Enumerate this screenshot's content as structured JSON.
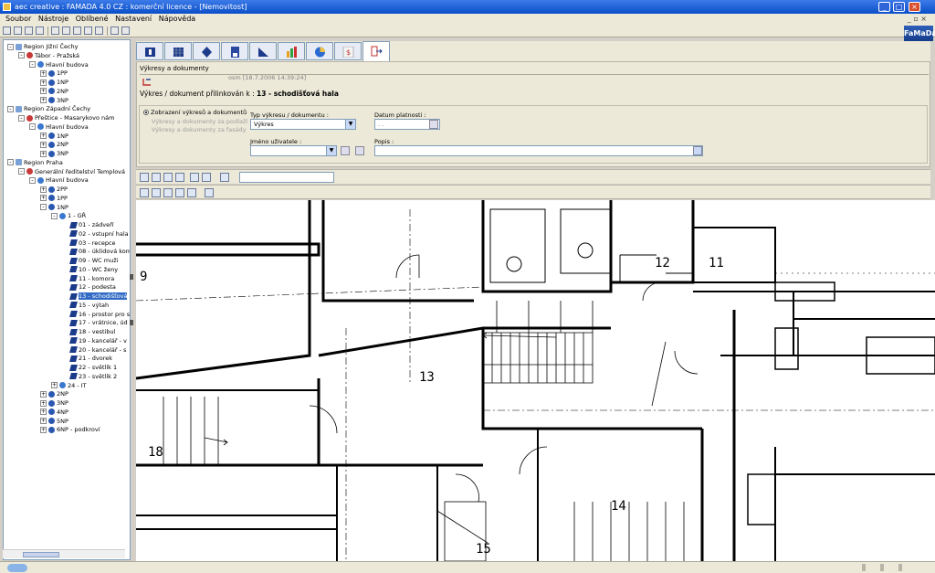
{
  "window": {
    "title": "aec creative : FAMADA 4.0 CZ : komerční licence - [Nemovitost]"
  },
  "menu": [
    "Soubor",
    "Nástroje",
    "Oblíbené",
    "Nastavení",
    "Nápověda"
  ],
  "logo": "FaMaDa",
  "tree": [
    {
      "label": "Region Jižní Čechy",
      "level": 0,
      "type": "region",
      "exp": "-"
    },
    {
      "label": "Tábor - Pražská",
      "level": 1,
      "type": "site",
      "exp": "-"
    },
    {
      "label": "Hlavní budova",
      "level": 2,
      "type": "bldg",
      "exp": "-"
    },
    {
      "label": "1PP",
      "level": 3,
      "type": "floor",
      "exp": "+"
    },
    {
      "label": "1NP",
      "level": 3,
      "type": "floor",
      "exp": "+"
    },
    {
      "label": "2NP",
      "level": 3,
      "type": "floor",
      "exp": "+"
    },
    {
      "label": "3NP",
      "level": 3,
      "type": "floor",
      "exp": "+"
    },
    {
      "label": "Region Západní Čechy",
      "level": 0,
      "type": "region",
      "exp": "-"
    },
    {
      "label": "Přeštice - Masarykovo nám",
      "level": 1,
      "type": "site",
      "exp": "-"
    },
    {
      "label": "Hlavní budova",
      "level": 2,
      "type": "bldg",
      "exp": "-"
    },
    {
      "label": "1NP",
      "level": 3,
      "type": "floor",
      "exp": "+"
    },
    {
      "label": "2NP",
      "level": 3,
      "type": "floor",
      "exp": "+"
    },
    {
      "label": "3NP",
      "level": 3,
      "type": "floor",
      "exp": "+"
    },
    {
      "label": "Region Praha",
      "level": 0,
      "type": "region",
      "exp": "-"
    },
    {
      "label": "Generální ředitelství Templová",
      "level": 1,
      "type": "site",
      "exp": "-"
    },
    {
      "label": "Hlavní budova",
      "level": 2,
      "type": "bldg",
      "exp": "-"
    },
    {
      "label": "2PP",
      "level": 3,
      "type": "floor",
      "exp": "+"
    },
    {
      "label": "1PP",
      "level": 3,
      "type": "floor",
      "exp": "+"
    },
    {
      "label": "1NP",
      "level": 3,
      "type": "floor",
      "exp": "-"
    },
    {
      "label": "1 - GŘ",
      "level": 4,
      "type": "bldg",
      "exp": "-"
    },
    {
      "label": "01 - zádveří",
      "level": 5,
      "type": "room"
    },
    {
      "label": "02 - vstupní hala",
      "level": 5,
      "type": "room"
    },
    {
      "label": "03 - recepce",
      "level": 5,
      "type": "room"
    },
    {
      "label": "08 - úklidová kom",
      "level": 5,
      "type": "room"
    },
    {
      "label": "09 - WC muži",
      "level": 5,
      "type": "room"
    },
    {
      "label": "10 - WC ženy",
      "level": 5,
      "type": "room"
    },
    {
      "label": "11 - komora",
      "level": 5,
      "type": "room"
    },
    {
      "label": "12 - podesta",
      "level": 5,
      "type": "room"
    },
    {
      "label": "13 - schodišťová",
      "level": 5,
      "type": "room",
      "selected": true
    },
    {
      "label": "15 - výtah",
      "level": 5,
      "type": "room"
    },
    {
      "label": "16 - prostor pro s",
      "level": 5,
      "type": "room"
    },
    {
      "label": "17 - vrátnice, úd",
      "level": 5,
      "type": "room"
    },
    {
      "label": "18 - vestibul",
      "level": 5,
      "type": "room"
    },
    {
      "label": "19 - kancelář - v",
      "level": 5,
      "type": "room"
    },
    {
      "label": "20 - kancelář - s",
      "level": 5,
      "type": "room"
    },
    {
      "label": "21 - dvorek",
      "level": 5,
      "type": "room"
    },
    {
      "label": "22 - světlík 1",
      "level": 5,
      "type": "room"
    },
    {
      "label": "23 - světlík 2",
      "level": 5,
      "type": "room"
    },
    {
      "label": "24 - IT",
      "level": 4,
      "type": "bldg",
      "exp": "+"
    },
    {
      "label": "2NP",
      "level": 3,
      "type": "floor",
      "exp": "+"
    },
    {
      "label": "3NP",
      "level": 3,
      "type": "floor",
      "exp": "+"
    },
    {
      "label": "4NP",
      "level": 3,
      "type": "floor",
      "exp": "+"
    },
    {
      "label": "5NP",
      "level": 3,
      "type": "floor",
      "exp": "+"
    },
    {
      "label": "6NP - podkroví",
      "level": 3,
      "type": "floor",
      "exp": "+"
    }
  ],
  "docs": {
    "section_title": "Výkresy a dokumenty",
    "author": "osm [18.7.2006 14:39:24]",
    "linked_prefix": "Výkres / dokument přilinkován k :",
    "linked_target": "13 - schodišťová hala",
    "radio_1": "Zobrazení výkresů a dokumentů",
    "radio_2": "Výkresy a dokumenty za podlaží",
    "radio_3": "Výkresy a dokumenty za fasády",
    "type_label": "Typ výkresu / dokumentu :",
    "type_value": "Výkres",
    "valid_label": "Datum platnosti :",
    "valid_value": ". .",
    "user_label": "Jméno uživatele :",
    "user_value": "",
    "desc_label": "Popis :",
    "desc_value": ""
  },
  "rooms": {
    "r9": "9",
    "r11": "11",
    "r12": "12",
    "r13": "13",
    "r14": "14",
    "r15": "15",
    "r18": "18"
  }
}
